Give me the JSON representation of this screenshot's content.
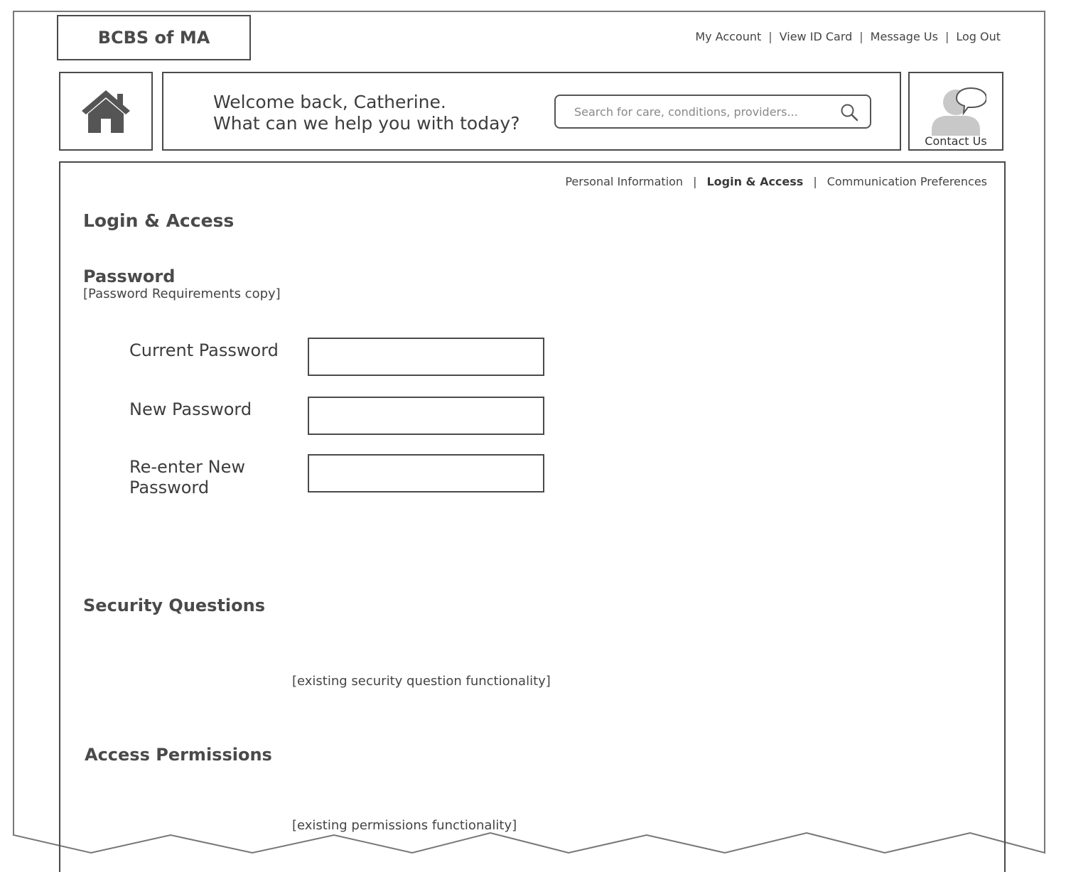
{
  "logo": {
    "text": "BCBS of MA"
  },
  "utility_nav": {
    "items": [
      "My Account",
      "View ID Card",
      "Message Us",
      "Log Out"
    ],
    "separator": "|"
  },
  "welcome": {
    "line1": "Welcome back, Catherine.",
    "line2": "What can we help you with today?"
  },
  "search": {
    "placeholder": "Search for care, conditions, providers..."
  },
  "contact": {
    "label": "Contact Us"
  },
  "sub_nav": {
    "items": [
      "Personal Information",
      "Login & Access",
      "Communication Preferences"
    ],
    "active_index": 1,
    "separator": "|"
  },
  "page_title": "Login & Access",
  "password": {
    "heading": "Password",
    "requirements": "[Password Requirements copy]",
    "fields": [
      {
        "label": "Current Password",
        "value": ""
      },
      {
        "label": "New Password",
        "value": ""
      },
      {
        "label": "Re-enter New Password",
        "value": ""
      }
    ]
  },
  "security_questions": {
    "heading": "Security Questions",
    "placeholder_text": "[existing security question functionality]"
  },
  "access_permissions": {
    "heading": "Access Permissions",
    "placeholder_text": "[existing permissions functionality]"
  },
  "colors": {
    "stroke": "#4a4a4a",
    "text": "#3d3d3d",
    "icon_fill": "#555555",
    "person_fill": "#c8c8c8"
  }
}
